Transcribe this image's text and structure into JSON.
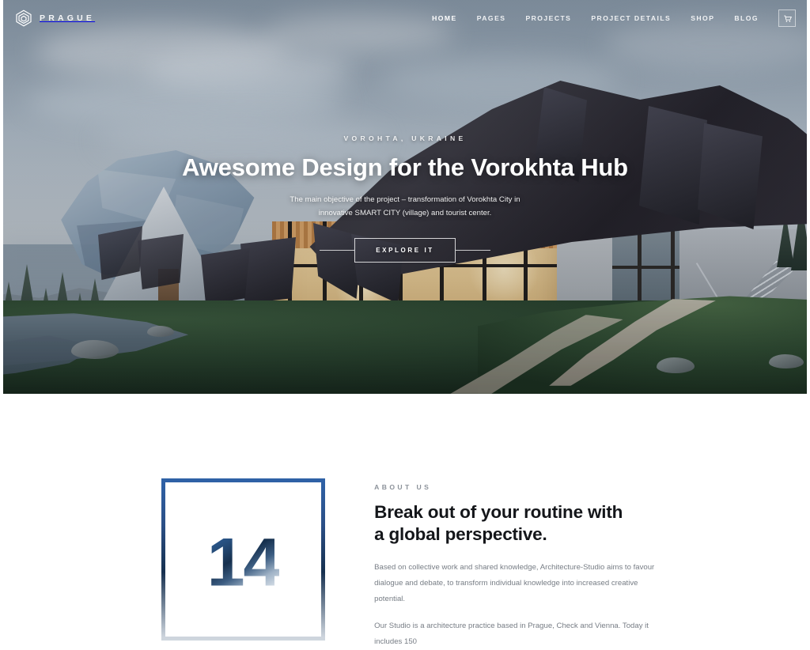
{
  "brand": {
    "name": "PRAGUE",
    "logo_icon": "hexagon-spiral-logo-icon"
  },
  "nav": {
    "items": [
      {
        "label": "HOME",
        "active": true
      },
      {
        "label": "PAGES",
        "active": false
      },
      {
        "label": "PROJECTS",
        "active": false
      },
      {
        "label": "PROJECT DETAILS",
        "active": false
      },
      {
        "label": "SHOP",
        "active": false
      },
      {
        "label": "BLOG",
        "active": false
      }
    ],
    "action_icon": "cart-icon"
  },
  "hero": {
    "eyebrow": "VOROHTA, UKRAINE",
    "title": "Awesome Design for the Vorokhta Hub",
    "subtitle": "The main objective of the project – transformation of Vorokhta City in innovative SMART CITY (village) and tourist center.",
    "cta_label": "EXPLORE IT"
  },
  "about": {
    "number": "14",
    "eyebrow": "ABOUT US",
    "title_line1": "Break out of your routine with",
    "title_line2": "a global perspective.",
    "paragraph1": "Based on collective work and shared knowledge, Architecture-Studio aims to favour dialogue and debate, to transform individual knowledge into increased creative potential.",
    "paragraph2": "Our Studio is a architecture practice based in Prague, Check and Vienna. Today it includes 150"
  },
  "colors": {
    "accent_blue": "#2f61a6",
    "deep_blue": "#16304f",
    "heading": "#14161a",
    "body_text": "#777d85",
    "eyebrow": "#8c929a"
  }
}
